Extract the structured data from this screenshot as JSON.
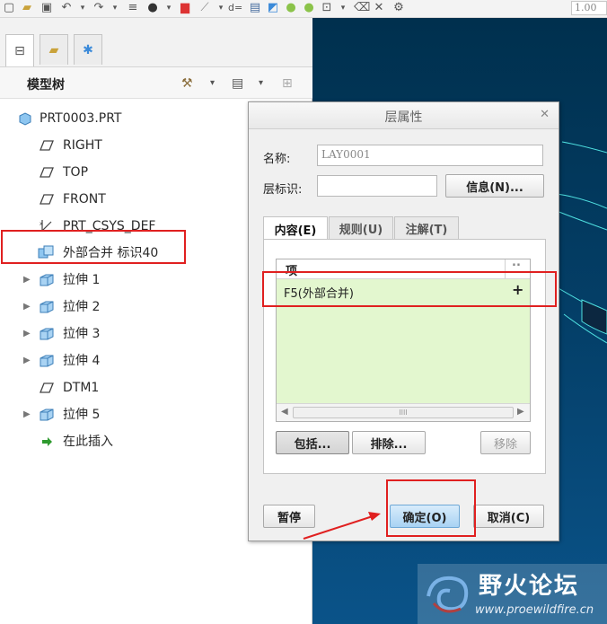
{
  "toolbar": {
    "zoom_value": "1.00"
  },
  "model_tree": {
    "title": "模型树",
    "items": [
      {
        "label": "PRT0003.PRT",
        "icon": "part-icon"
      },
      {
        "label": "RIGHT",
        "icon": "datum-plane-icon"
      },
      {
        "label": "TOP",
        "icon": "datum-plane-icon"
      },
      {
        "label": "FRONT",
        "icon": "datum-plane-icon"
      },
      {
        "label": "PRT_CSYS_DEF",
        "icon": "csys-icon"
      },
      {
        "label": "外部合并 标识40",
        "icon": "merge-feature-icon"
      },
      {
        "label": "拉伸 1",
        "icon": "extrude-icon"
      },
      {
        "label": "拉伸 2",
        "icon": "extrude-icon"
      },
      {
        "label": "拉伸 3",
        "icon": "extrude-icon"
      },
      {
        "label": "拉伸 4",
        "icon": "extrude-icon"
      },
      {
        "label": "DTM1",
        "icon": "datum-plane-icon"
      },
      {
        "label": "拉伸 5",
        "icon": "extrude-icon"
      },
      {
        "label": "在此插入",
        "icon": "insert-here-icon"
      }
    ]
  },
  "dialog": {
    "title": "层属性",
    "name_label": "名称:",
    "name_value": "LAY0001",
    "layer_id_label": "层标识:",
    "layer_id_value": "",
    "info_button": "信息(N)...",
    "tabs": [
      "内容(E)",
      "规则(U)",
      "注解(T)"
    ],
    "list": {
      "column_header": "项",
      "column_header_right": "..",
      "items": [
        {
          "label": "F5(外部合并)",
          "status": "+"
        }
      ],
      "scroll_thumb_grip": "IIII"
    },
    "include_button": "包括...",
    "exclude_button": "排除...",
    "remove_button": "移除",
    "pause_button": "暂停",
    "ok_button": "确定(O)",
    "cancel_button": "取消(C)"
  },
  "watermark": {
    "title": "野火论坛",
    "url": "www.proewildfire.cn"
  },
  "colors": {
    "highlight_row": "#e3f7cf",
    "annotation_red": "#e02020",
    "viewport_top": "#00304e",
    "viewport_bottom": "#0a5389",
    "primary_button": "#a8d2f3"
  }
}
